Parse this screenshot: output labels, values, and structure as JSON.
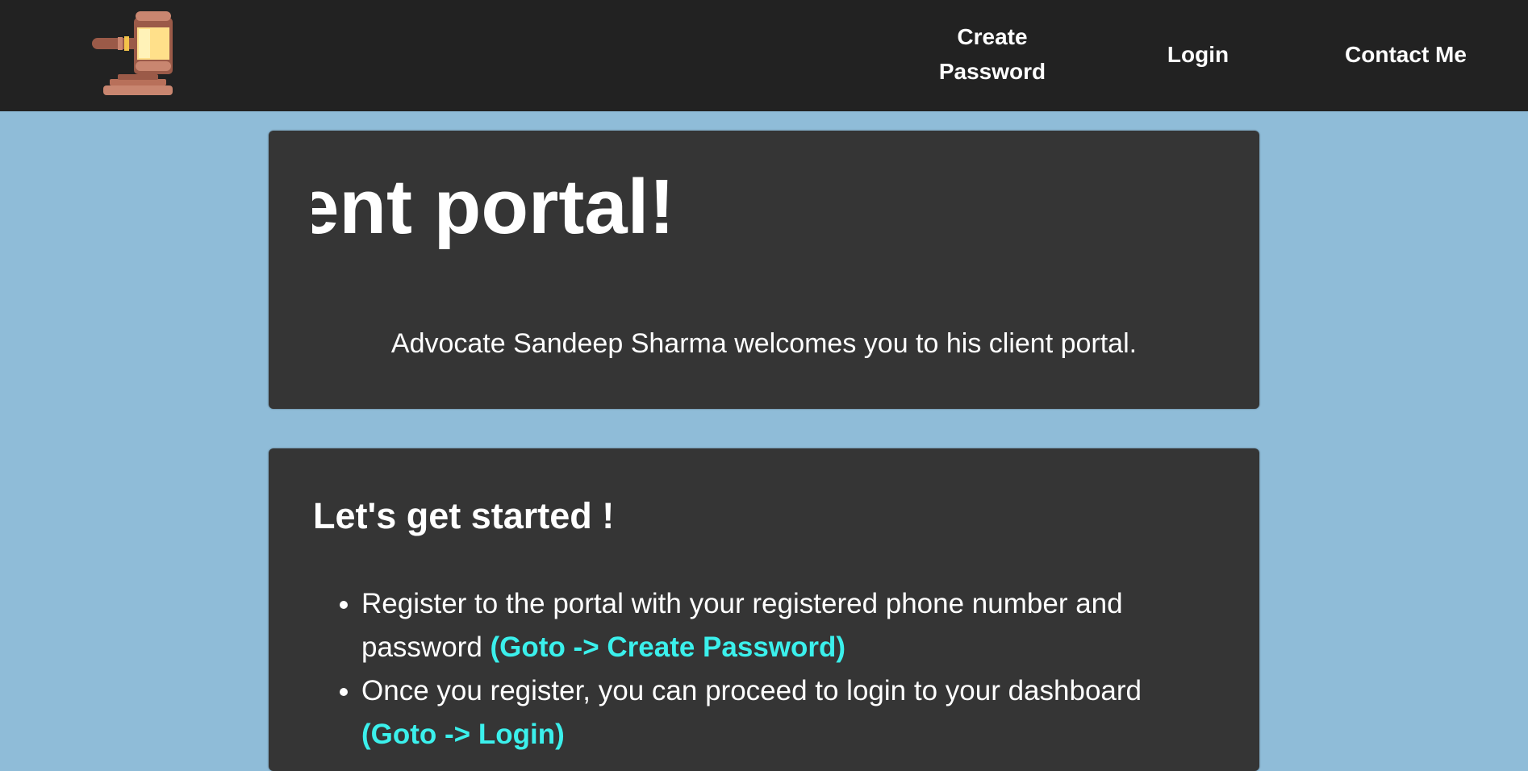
{
  "navbar": {
    "logo_icon": "gavel-icon",
    "links": [
      {
        "label": "Create\nPassword",
        "line1": "Create",
        "line2": "Password"
      },
      {
        "label": "Login"
      },
      {
        "label": "Contact Me"
      }
    ]
  },
  "hero": {
    "title_visible": "ent portal!",
    "subtitle": "Advocate Sandeep Sharma welcomes you to his client portal."
  },
  "getting_started": {
    "heading": "Let's get started !",
    "items": [
      {
        "text": "Register to the portal with your registered phone number and password ",
        "link": "(Goto -> Create Password)"
      },
      {
        "text": "Once you register, you can proceed to login to your dashboard ",
        "link": "(Goto -> Login)"
      }
    ]
  },
  "colors": {
    "navbar_bg": "#222222",
    "page_bg": "#8fbcd8",
    "card_bg": "#353535",
    "link_accent": "#3bf0ec"
  }
}
